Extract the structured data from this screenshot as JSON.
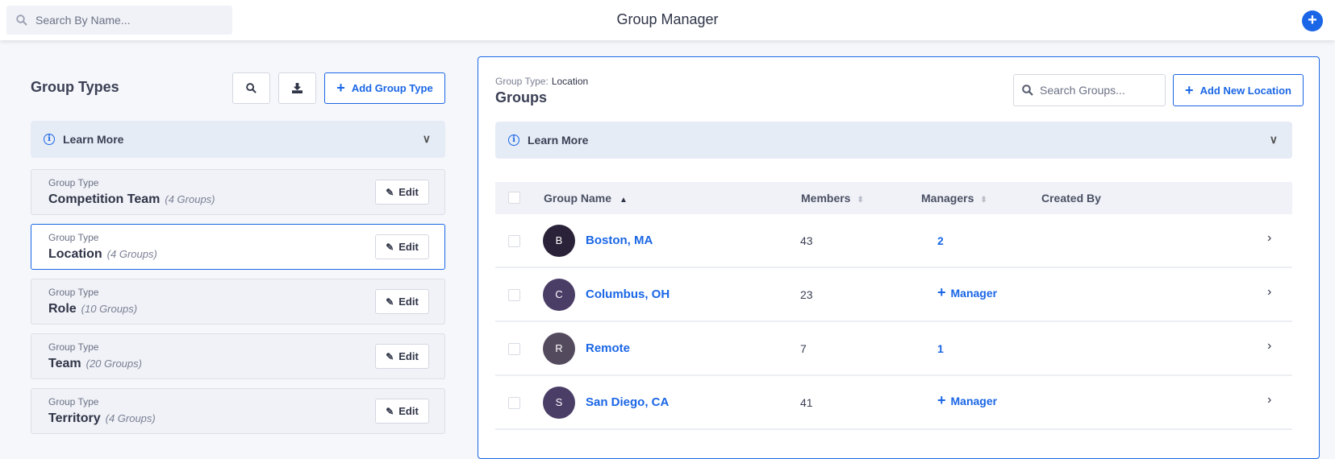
{
  "header": {
    "search_placeholder": "Search By Name...",
    "title": "Group Manager",
    "add_label": "+"
  },
  "left": {
    "title": "Group Types",
    "add_label": "Add Group Type",
    "learn_more": "Learn More",
    "types": [
      {
        "key": "Group Type",
        "name": "Competition Team",
        "count": "(4 Groups)",
        "edit": "Edit"
      },
      {
        "key": "Group Type",
        "name": "Location",
        "count": "(4 Groups)",
        "edit": "Edit"
      },
      {
        "key": "Group Type",
        "name": "Role",
        "count": "(10 Groups)",
        "edit": "Edit"
      },
      {
        "key": "Group Type",
        "name": "Team",
        "count": "(20 Groups)",
        "edit": "Edit"
      },
      {
        "key": "Group Type",
        "name": "Territory",
        "count": "(4 Groups)",
        "edit": "Edit"
      }
    ]
  },
  "right": {
    "type_label": "Group Type:",
    "type_value": "Location",
    "title": "Groups",
    "search_placeholder": "Search Groups...",
    "add_label": "Add New Location",
    "learn_more": "Learn More",
    "columns": {
      "name": "Group Name",
      "members": "Members",
      "managers": "Managers",
      "created_by": "Created By"
    },
    "rows": [
      {
        "initial": "B",
        "name": "Boston, MA",
        "members": "43",
        "managers": "2",
        "color": "#2a2238"
      },
      {
        "initial": "C",
        "name": "Columbus, OH",
        "members": "23",
        "managers": "Manager",
        "color": "#4a3d66"
      },
      {
        "initial": "R",
        "name": "Remote",
        "members": "7",
        "managers": "1",
        "color": "#544a5e"
      },
      {
        "initial": "S",
        "name": "San Diego, CA",
        "members": "41",
        "managers": "Manager",
        "color": "#4a3d66"
      }
    ]
  },
  "colors": {
    "accent": "#1a66e6"
  }
}
